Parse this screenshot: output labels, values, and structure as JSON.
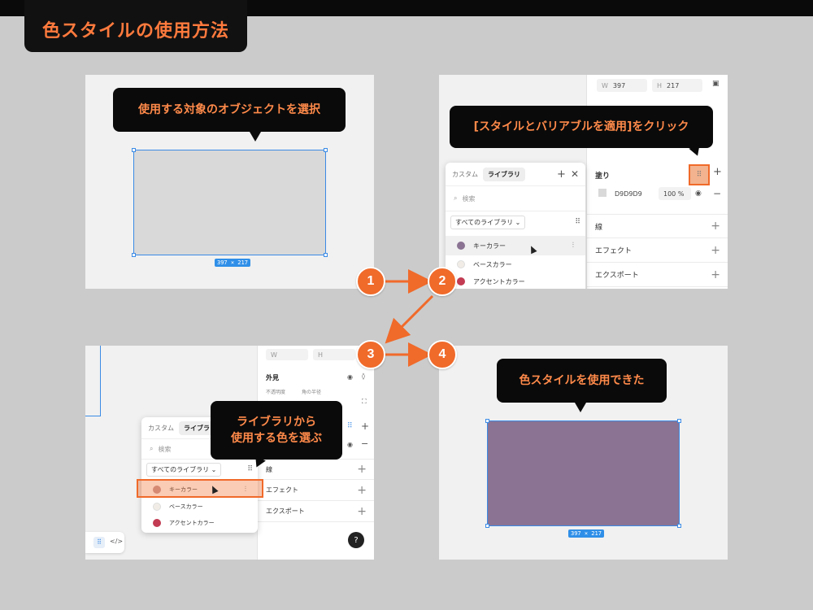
{
  "title": "色スタイルの使用方法",
  "steps": [
    "1",
    "2",
    "3",
    "4"
  ],
  "colors": {
    "accent": "#f06a2a",
    "callout_text": "#ff8a4a",
    "key_color": "#8a7393",
    "base_color": "#f1ede6",
    "accent_color": "#c23b52",
    "selection": "#3b8be6"
  },
  "panel1": {
    "callout": "使用する対象のオブジェクトを選択",
    "dimension": "397 × 217"
  },
  "panel2": {
    "callout": "[スタイルとバリアブルを適用]をクリック",
    "w_label": "W",
    "w_value": "397",
    "h_label": "H",
    "h_value": "217",
    "fill_label": "塗り",
    "fill_hex": "D9D9D9",
    "fill_opacity": "100",
    "percent": "%",
    "stroke_label": "線",
    "effect_label": "エフェクト",
    "export_label": "エクスポート",
    "library": {
      "tab_custom": "カスタム",
      "tab_library": "ライブラリ",
      "search_placeholder": "検索",
      "dropdown": "すべてのライブラリ",
      "items": [
        "キーカラー",
        "ベースカラー",
        "アクセントカラー"
      ]
    }
  },
  "panel3": {
    "callout_line1": "ライブラリから",
    "callout_line2": "使用する色を選ぶ",
    "w_label": "W",
    "h_label": "H",
    "appearance_label": "外見",
    "opacity_label": "不透明度",
    "radius_label": "角の半径",
    "stroke_label": "線",
    "effect_label": "エフェクト",
    "export_label": "エクスポート",
    "help": "?",
    "library": {
      "tab_custom": "カスタム",
      "tab_library": "ライブラリ",
      "search_placeholder": "検索",
      "dropdown": "すべてのライブラリ",
      "items": [
        "キーカラー",
        "ベースカラー",
        "アクセントカラー"
      ]
    }
  },
  "panel4": {
    "callout": "色スタイルを使用できた",
    "dimension": "397 × 217"
  }
}
